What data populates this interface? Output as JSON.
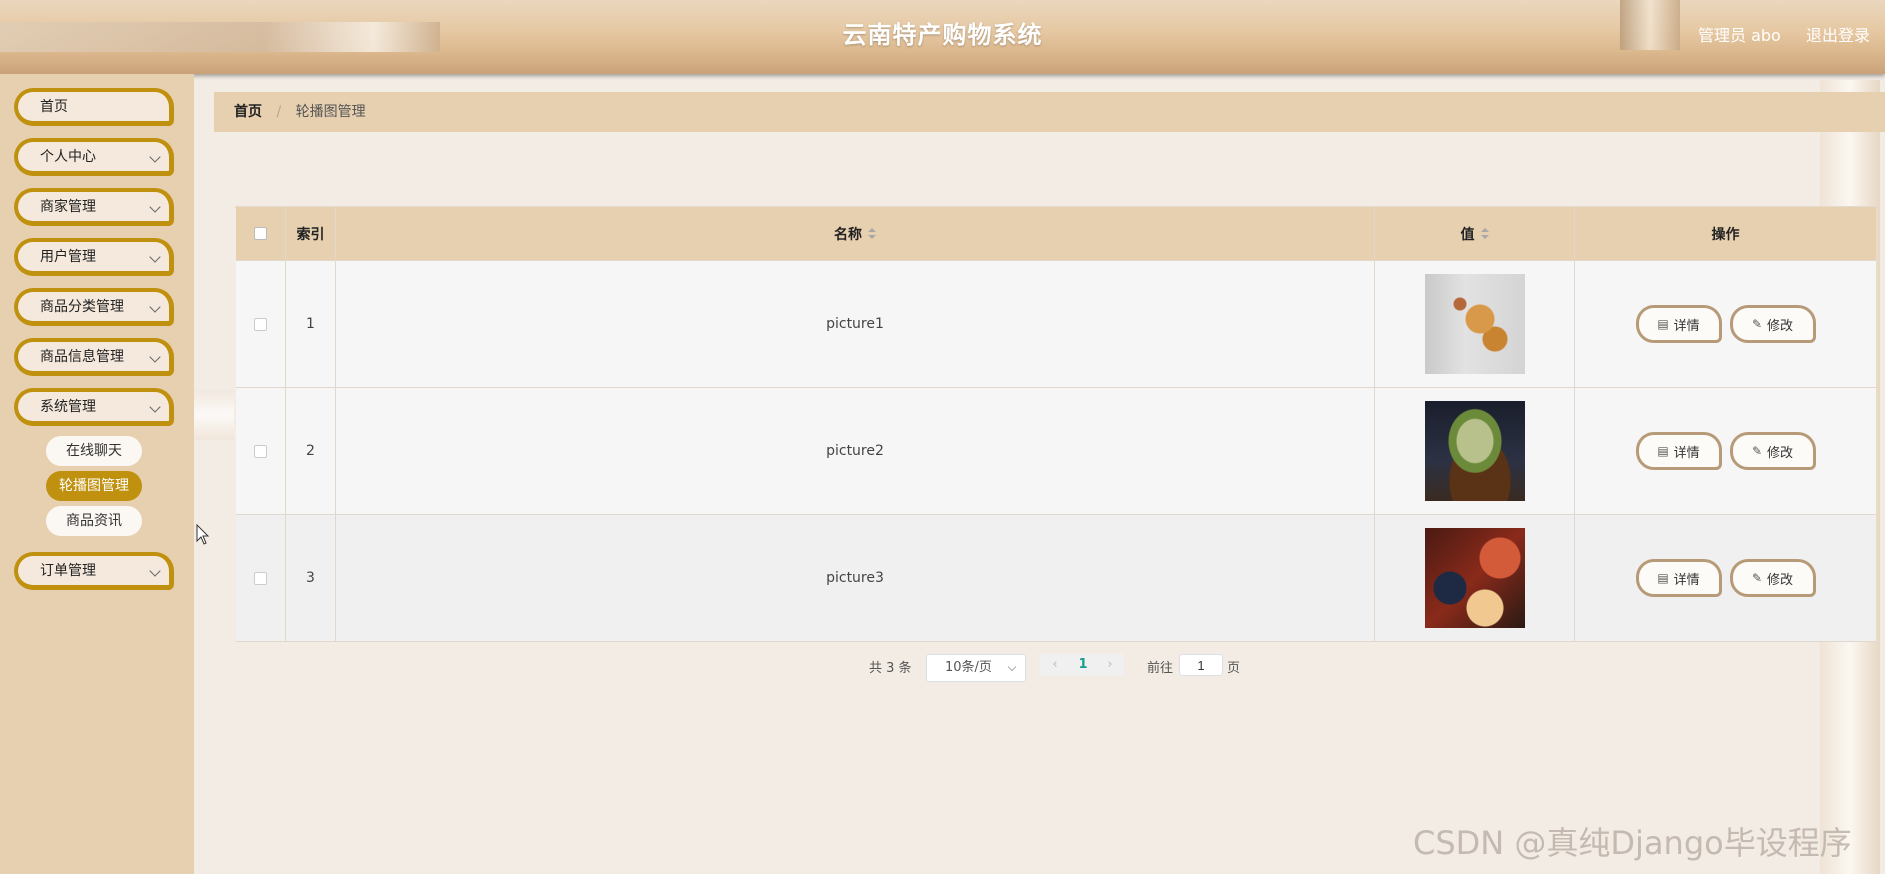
{
  "header": {
    "title": "云南特产购物系统",
    "user": "管理员 abo",
    "logout": "退出登录"
  },
  "sidebar": {
    "items": [
      {
        "label": "首页"
      },
      {
        "label": "个人中心"
      },
      {
        "label": "商家管理"
      },
      {
        "label": "用户管理"
      },
      {
        "label": "商品分类管理"
      },
      {
        "label": "商品信息管理"
      },
      {
        "label": "系统管理"
      },
      {
        "label": "订单管理"
      }
    ],
    "sub_items": [
      {
        "label": "在线聊天"
      },
      {
        "label": "轮播图管理",
        "active": true
      },
      {
        "label": "商品资讯"
      }
    ]
  },
  "breadcrumb": {
    "home": "首页",
    "separator": "/",
    "current": "轮播图管理"
  },
  "table": {
    "columns": [
      "索引",
      "名称",
      "值",
      "操作"
    ],
    "rows": [
      {
        "index": "1",
        "name": "picture1",
        "value_image": "food-photo-1"
      },
      {
        "index": "2",
        "name": "picture2",
        "value_image": "food-photo-2"
      },
      {
        "index": "3",
        "name": "picture3",
        "value_image": "food-photo-3"
      }
    ],
    "actions": {
      "detail": "详情",
      "edit": "修改"
    }
  },
  "pagination": {
    "total": "共 3 条",
    "page_size": "10条/页",
    "prev": "‹",
    "current_page": "1",
    "next": "›",
    "goto_label": "前往",
    "goto_value": "1",
    "page_suffix": "页"
  },
  "watermark": "CSDN @真纯Django毕设程序"
}
